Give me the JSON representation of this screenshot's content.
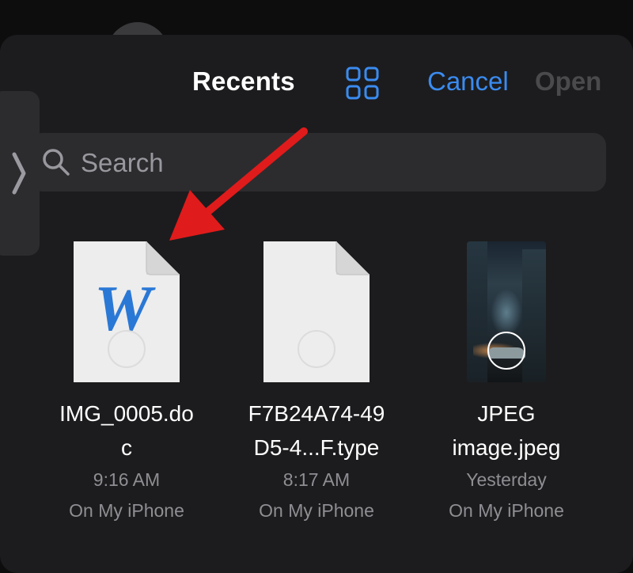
{
  "header": {
    "title": "Recents",
    "cancel_label": "Cancel",
    "open_label": "Open"
  },
  "search": {
    "placeholder": "Search"
  },
  "files": [
    {
      "name_line1": "IMG_0005.do",
      "name_line2": "c",
      "time": "9:16 AM",
      "location": "On My iPhone",
      "icon": "word-document-icon"
    },
    {
      "name_line1": "F7B24A74-49",
      "name_line2": "D5-4...F.type",
      "time": "8:17 AM",
      "location": "On My iPhone",
      "icon": "blank-document-icon"
    },
    {
      "name_line1": "JPEG",
      "name_line2": "image.jpeg",
      "time": "Yesterday",
      "location": "On My iPhone",
      "icon": "image-thumbnail"
    }
  ],
  "colors": {
    "accent": "#3a8bf0",
    "annotation_arrow": "#e01b1b",
    "word_blue": "#2a78d6"
  }
}
